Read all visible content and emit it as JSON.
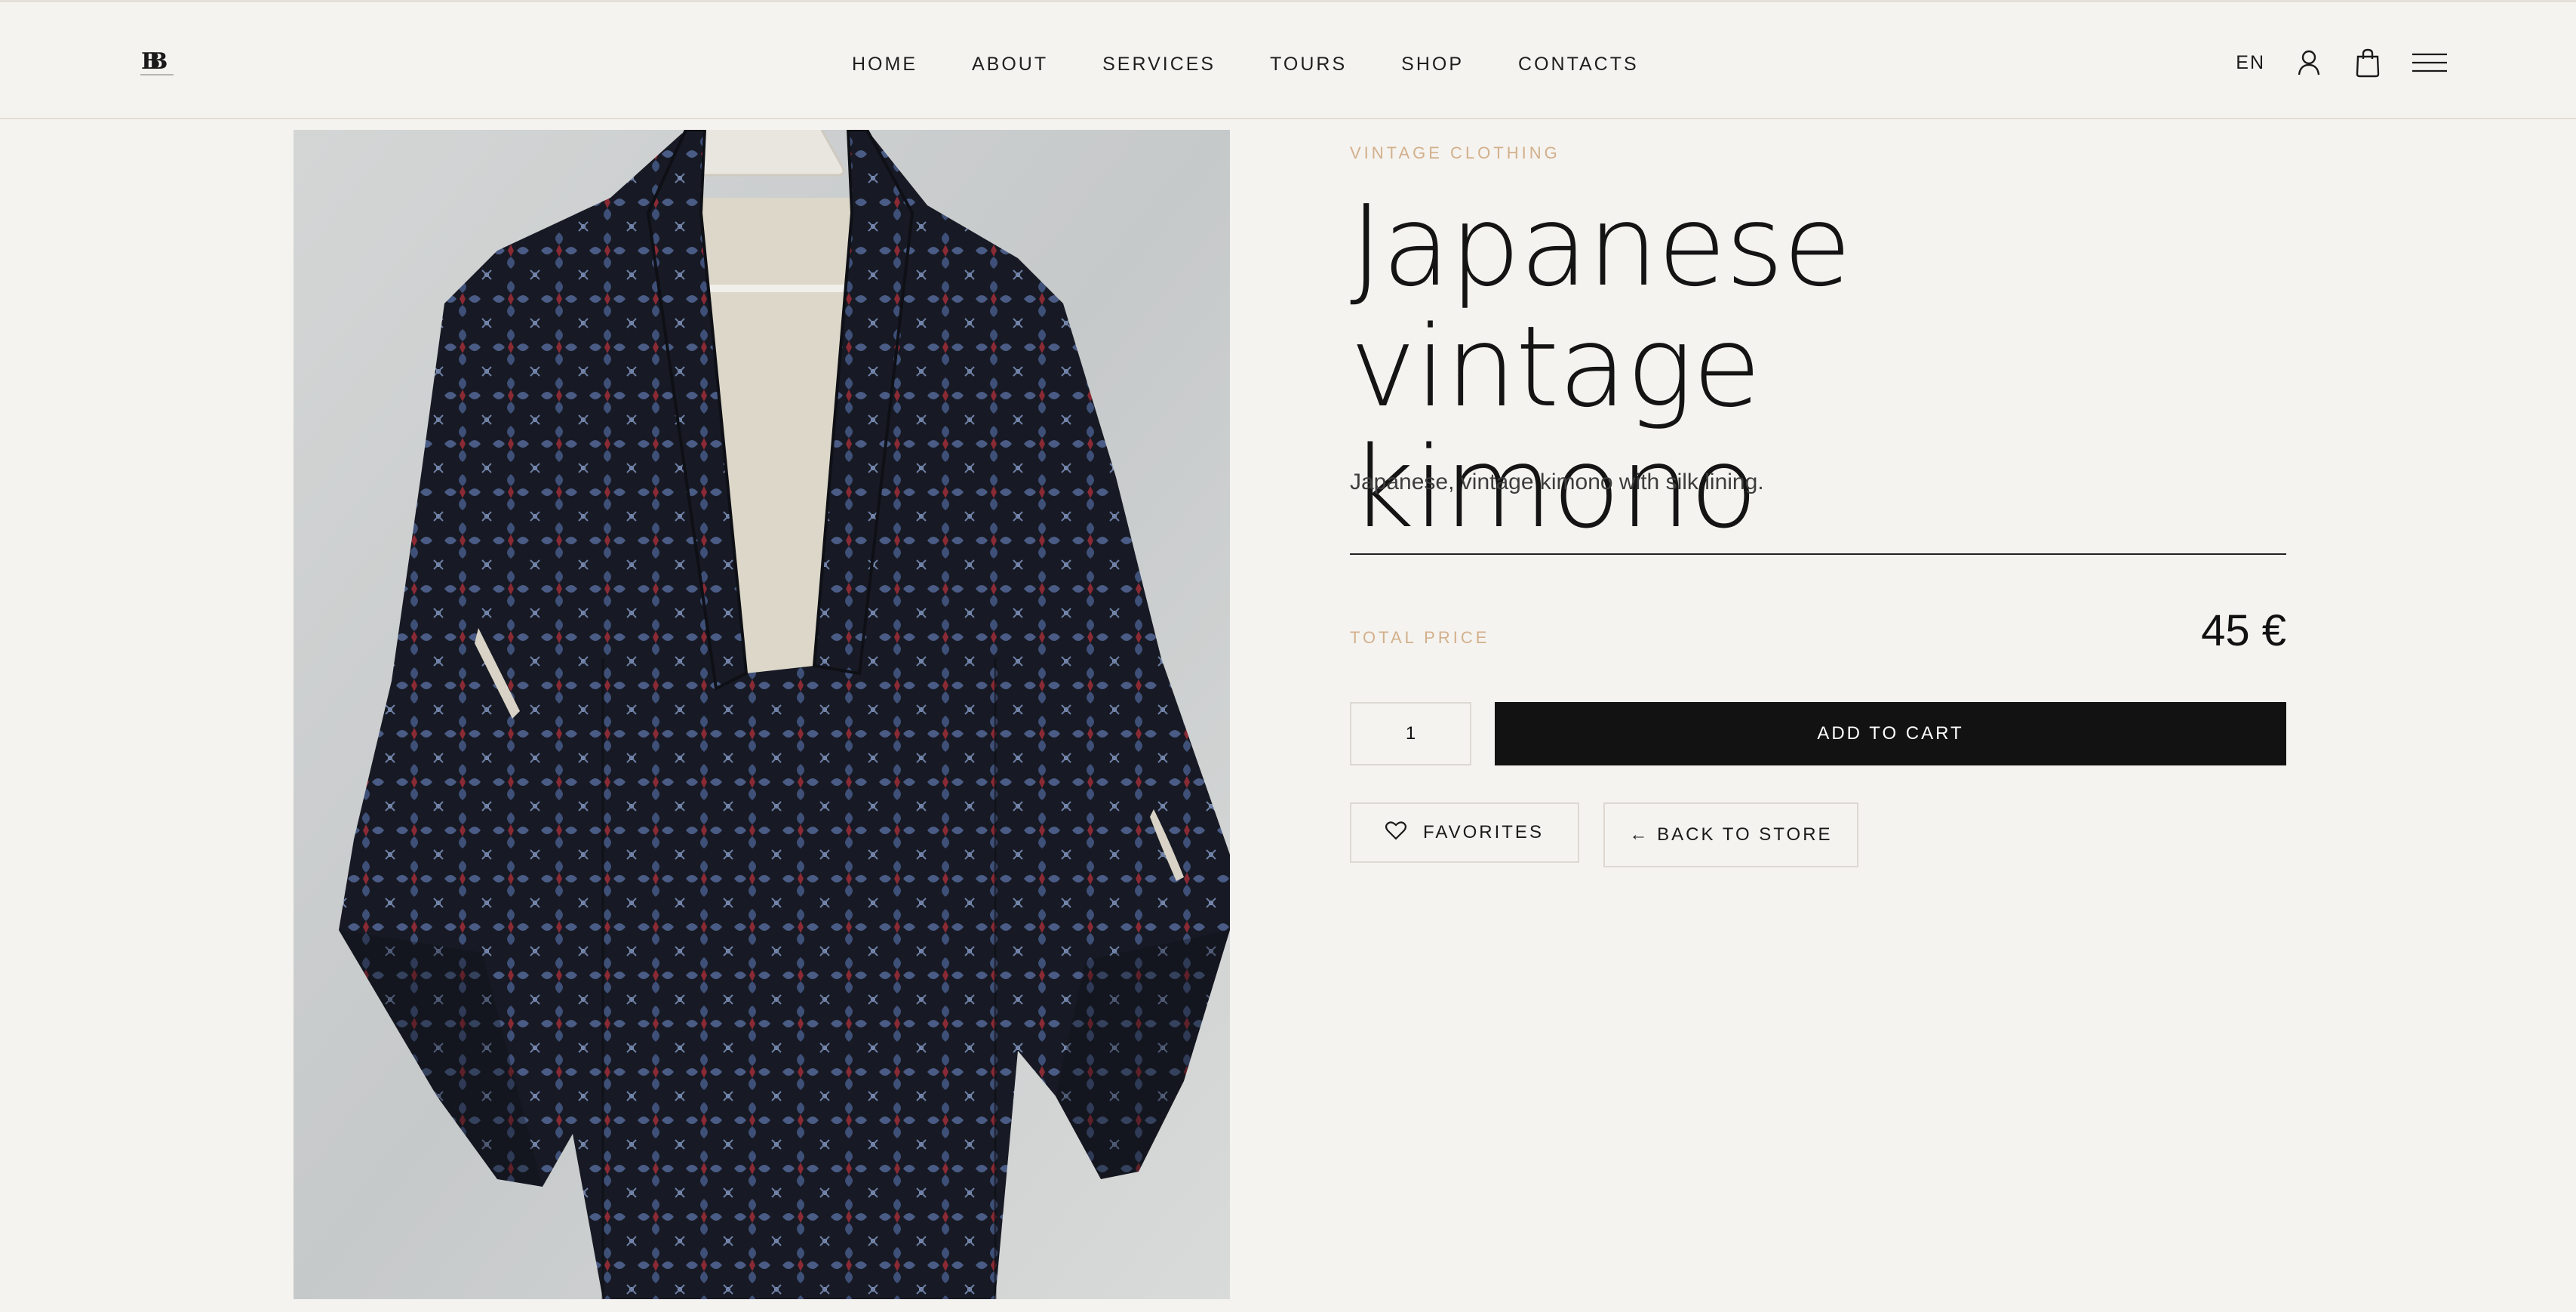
{
  "header": {
    "nav": [
      "HOME",
      "ABOUT",
      "SERVICES",
      "TOURS",
      "SHOP",
      "CONTACTS"
    ],
    "language": "EN",
    "icons": [
      "user-icon",
      "shopping-bag-icon",
      "menu-icon"
    ]
  },
  "product": {
    "category": "VINTAGE CLOTHING",
    "title_line1": "Japanese vintage",
    "title_line2": "kimono",
    "description": "Japanese, vintage kimono with silk lining.",
    "total_price_label": "TOTAL PRICE",
    "price": "45 €",
    "quantity": "1",
    "add_to_cart_label": "ADD TO CART",
    "favorites_label": "FAVORITES",
    "back_to_store_label": "← BACK TO STORE"
  },
  "colors": {
    "background": "#f5f3ef",
    "accent_label": "#d2b08c",
    "button_dark": "#121212"
  }
}
